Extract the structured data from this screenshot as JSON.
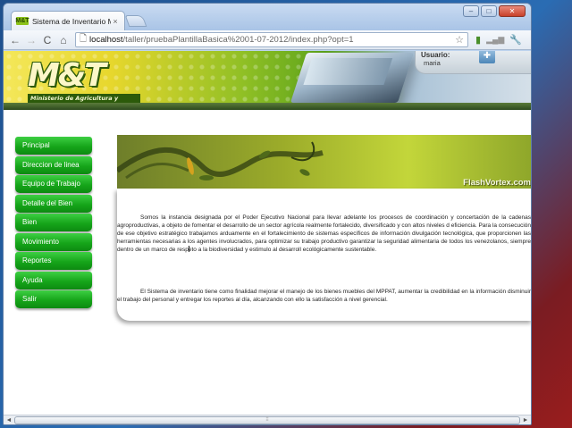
{
  "browser": {
    "tab_title": "Sistema de Inventario MPPAT",
    "tab_favicon_text": "M&T",
    "tab_close": "×",
    "url_host": "localhost",
    "url_path": "/taller/pruebaPlantillaBasica%2001-07-2012/index.php?opt=1",
    "window_buttons": {
      "minimize": "–",
      "maximize": "□",
      "close": "✕"
    },
    "nav": {
      "back": "←",
      "forward": "→",
      "reload": "C",
      "home": "⌂"
    }
  },
  "header": {
    "logo_text": "M&T",
    "org_name": "Ministerio de Agricultura y Tierras",
    "user_label": "Usuario:",
    "user_name": "maria"
  },
  "menu": {
    "items": [
      {
        "label": "Principal"
      },
      {
        "label": "Direccion de linea"
      },
      {
        "label": "Equipo de Trabajo"
      },
      {
        "label": "Detalle del Bien"
      },
      {
        "label": "Bien"
      },
      {
        "label": "Movimiento"
      },
      {
        "label": "Reportes"
      },
      {
        "label": "Ayuda"
      },
      {
        "label": "Salir"
      }
    ]
  },
  "flash": {
    "watermark": "FlashVortex.com"
  },
  "content": {
    "paragraph1": "Somos la instancia designada por el Poder Ejecutivo Nacional para llevar adelante los procesos de coordinación y concertación de la cadenas agroproductivas, a objeto de fomentar el desarrollo de un sector agrícola realmente fortalecido, diversificado y con altos niveles d eficiencia. Para la consecución de ese objetivo estratégico trabajamos arduamente en el fortalecimiento de sistemas específicos de información divulgación tecnológica, que proporcionen las herramientas necesarias a los agentes involucrados, para optimizar su trabajo productivo garantizar la seguridad alimentaria de todos los venezolanos, siempre dentro de un marco de respeto a la biodiversidad y estimulo al desarroll ecológicamente sustentable.",
    "paragraph2": "El Sistema de inventario tiene como finalidad mejorar el manejo de los bienes muebles del MPPAT, aumentar la credibilidad en la información disminuir el trabajo del personal y entregar los reportes al día, alcanzando con ello la satisfacción a nivel gerencial."
  },
  "scrollbar": {
    "left": "◄",
    "right": "►",
    "grip": "⁞⁞"
  }
}
